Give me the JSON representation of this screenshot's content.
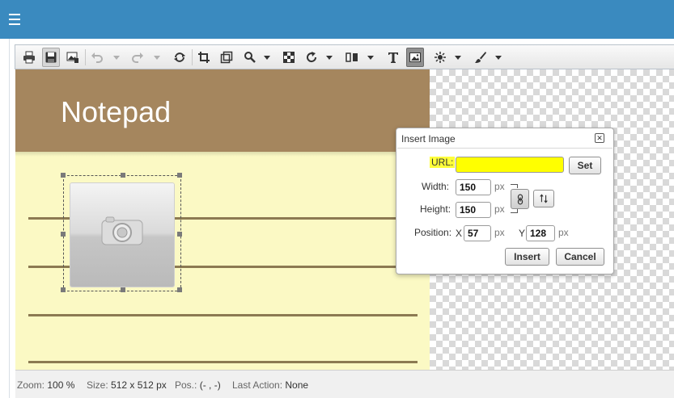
{
  "toolbar": {
    "icons": [
      "print-icon",
      "save-icon",
      "save-image-icon",
      "undo-icon",
      "redo-icon",
      "sync-icon",
      "crop-icon",
      "resize-icon",
      "zoom-icon",
      "transparency-icon",
      "rotate-icon",
      "flip-icon",
      "text-icon",
      "insert-image-icon",
      "effects-icon",
      "brush-icon"
    ]
  },
  "notepad": {
    "title": "Notepad",
    "header_color": "#a5865e",
    "paper_color": "#fbf9c4",
    "line_color": "#8c7a52"
  },
  "status": {
    "zoom_label": "Zoom:",
    "zoom_value": "100 %",
    "size_label": "Size:",
    "size_value": "512 x 512 px",
    "pos_label": "Pos.:",
    "pos_value": "(- , -)",
    "action_label": "Last Action:",
    "action_value": "None"
  },
  "dialog": {
    "title": "Insert Image",
    "close_glyph": "✕",
    "url_label": "URL:",
    "url_value": "",
    "set_label": "Set",
    "width_label": "Width:",
    "width_value": "150",
    "height_label": "Height:",
    "height_value": "150",
    "position_label": "Position:",
    "x_label": "X",
    "x_value": "57",
    "y_label": "Y",
    "y_value": "128",
    "unit": "px",
    "insert_label": "Insert",
    "cancel_label": "Cancel",
    "highlight_color": "#ffff00"
  },
  "colors": {
    "topbar": "#3a8abf"
  }
}
